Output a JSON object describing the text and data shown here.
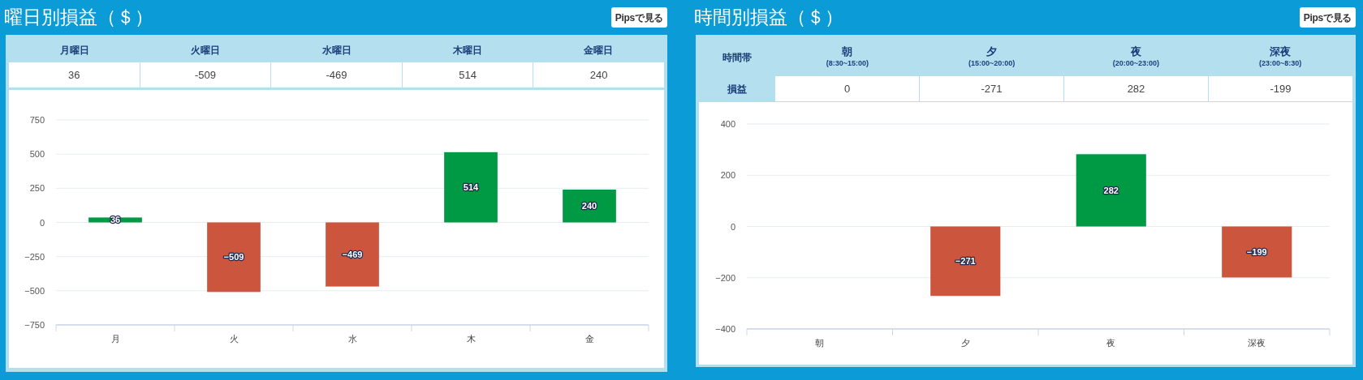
{
  "panels": [
    {
      "title": "曜日別損益（＄）",
      "button": "Pipsで見る",
      "table": {
        "columns": [
          {
            "label": "月曜日"
          },
          {
            "label": "火曜日"
          },
          {
            "label": "水曜日"
          },
          {
            "label": "木曜日"
          },
          {
            "label": "金曜日"
          }
        ],
        "values": [
          "36",
          "-509",
          "-469",
          "514",
          "240"
        ]
      },
      "chart_data": {
        "type": "bar",
        "categories": [
          "月",
          "火",
          "水",
          "木",
          "金"
        ],
        "series": [
          {
            "color": "#009a44",
            "values": [
              36,
              null,
              null,
              514,
              240
            ]
          },
          {
            "color": "#cc553d",
            "values": [
              null,
              -509,
              -469,
              null,
              null
            ]
          }
        ],
        "stacked": true,
        "grid": true,
        "ylim": [
          -750,
          750
        ],
        "yticks": [
          {
            "value": 750,
            "label": "750"
          },
          {
            "value": 500,
            "label": "500"
          },
          {
            "value": 250,
            "label": "250"
          },
          {
            "value": 0,
            "label": "0"
          },
          {
            "value": -250,
            "label": "−250"
          },
          {
            "value": -500,
            "label": "−500"
          },
          {
            "value": -750,
            "label": "−750"
          }
        ],
        "data_labels": true,
        "value_labels": [
          "36",
          "−509",
          "−469",
          "514",
          "240"
        ]
      }
    },
    {
      "title": "時間別損益（＄）",
      "button": "Pipsで見る",
      "table": {
        "header_label": "時間帯",
        "row_label": "損益",
        "columns": [
          {
            "label": "朝",
            "sub": "(8:30~15:00)"
          },
          {
            "label": "夕",
            "sub": "(15:00~20:00)"
          },
          {
            "label": "夜",
            "sub": "(20:00~23:00)"
          },
          {
            "label": "深夜",
            "sub": "(23:00~8:30)"
          }
        ],
        "values": [
          "0",
          "-271",
          "282",
          "-199"
        ]
      },
      "chart_data": {
        "type": "bar",
        "categories": [
          "朝",
          "夕",
          "夜",
          "深夜"
        ],
        "series": [
          {
            "color": "#009a44",
            "values": [
              0,
              null,
              282,
              null
            ]
          },
          {
            "color": "#cc553d",
            "values": [
              null,
              -271,
              null,
              -199
            ]
          }
        ],
        "stacked": true,
        "grid": true,
        "ylim": [
          -400,
          400
        ],
        "yticks": [
          {
            "value": 400,
            "label": "400"
          },
          {
            "value": 200,
            "label": "200"
          },
          {
            "value": 0,
            "label": "0"
          },
          {
            "value": -200,
            "label": "−200"
          },
          {
            "value": -400,
            "label": "−400"
          }
        ],
        "data_labels": true,
        "value_labels": [
          null,
          "−271",
          "282",
          "−199"
        ]
      }
    }
  ]
}
